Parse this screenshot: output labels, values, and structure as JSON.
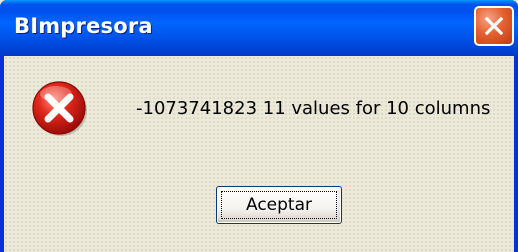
{
  "window": {
    "title": "BImpresora"
  },
  "dialog": {
    "icon": "error-icon",
    "message": "-1073741823 11 values for 10 columns",
    "ok_label": "Aceptar"
  },
  "titlebar": {
    "close_icon": "close-icon"
  },
  "colors": {
    "titlebar_blue": "#0055eb",
    "close_red": "#e4612f",
    "dialog_bg": "#ece9d8",
    "error_red": "#d8201a"
  }
}
